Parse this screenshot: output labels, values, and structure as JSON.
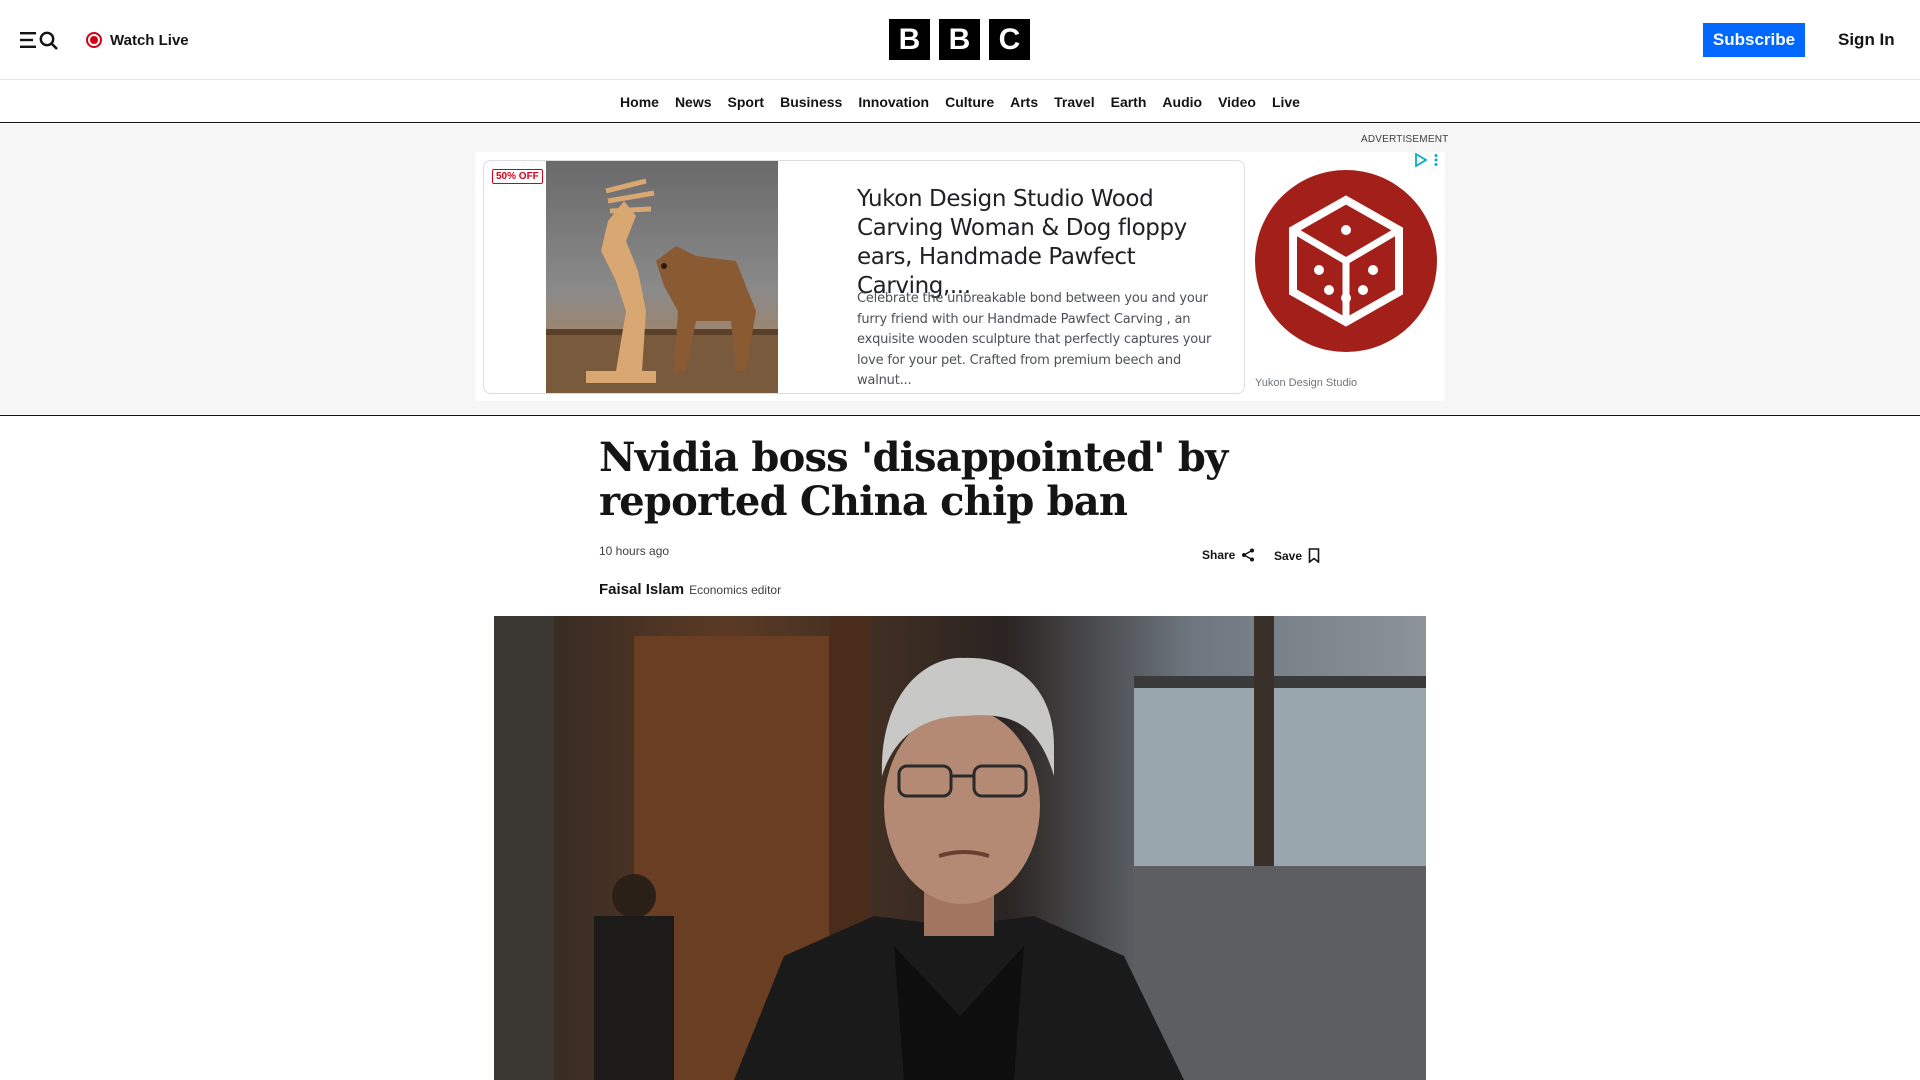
{
  "header": {
    "watch_live": "Watch Live",
    "logo_letters": [
      "B",
      "B",
      "C"
    ],
    "subscribe": "Subscribe",
    "sign_in": "Sign In"
  },
  "nav": {
    "items": [
      "Home",
      "News",
      "Sport",
      "Business",
      "Innovation",
      "Culture",
      "Arts",
      "Travel",
      "Earth",
      "Audio",
      "Video",
      "Live"
    ]
  },
  "ad": {
    "label": "ADVERTISEMENT",
    "badge": "50% OFF",
    "title": "Yukon Design Studio Wood Carving Woman & Dog floppy ears, Handmade Pawfect Carving,...",
    "description": "Celebrate the unbreakable bond between you and your furry friend with our Handmade Pawfect Carving , an exquisite wooden sculpture that perfectly captures your love for your pet. Crafted from premium beech and walnut...",
    "advertiser": "Yukon Design Studio"
  },
  "article": {
    "headline": "Nvidia boss 'disappointed' by reported China chip ban",
    "timestamp": "10 hours ago",
    "share_label": "Share",
    "save_label": "Save",
    "author": "Faisal Islam",
    "author_role": "Economics editor"
  },
  "colors": {
    "accent": "#0068ff",
    "live_red": "#d4001a",
    "ad_logo_red": "#a31f1a"
  }
}
